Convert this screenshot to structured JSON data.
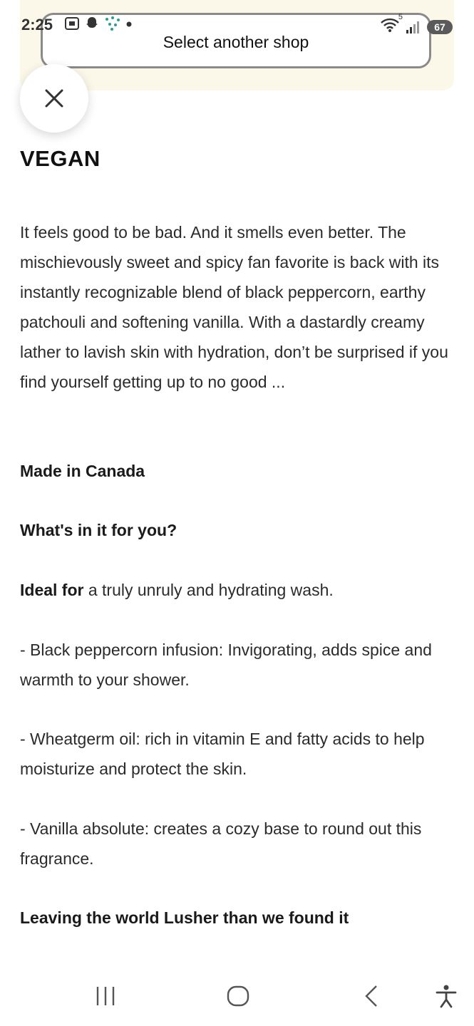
{
  "status_bar": {
    "time": "2:25",
    "wifi_label": "5",
    "battery": "67"
  },
  "shop_banner": {
    "button_label": "Select another shop"
  },
  "product": {
    "title": "VEGAN",
    "description": "It feels good to be bad. And it smells even better. The mischievously sweet and spicy fan favorite is back with its instantly recognizable blend of black peppercorn, earthy patchouli and softening vanilla. With a dastardly creamy lather to lavish skin with hydration, don’t be surprised if you find yourself getting up to no good ...",
    "made_in": "Made in Canada",
    "whats_in_heading": "What's in it for you?",
    "ideal_for_label": "Ideal for",
    "ideal_for_text": " a truly unruly and hydrating wash.",
    "bullets": [
      "- Black peppercorn infusion: Invigorating, adds spice and warmth to your shower.",
      "- Wheatgerm oil: rich in vitamin E and fatty acids to help moisturize and protect the skin.",
      "- Vanilla absolute: creates a cozy base to round out this fragrance."
    ],
    "closing_heading": "Leaving the world Lusher than we found it"
  },
  "icons": {
    "close": "close-icon",
    "recents": "recents-icon",
    "home": "home-icon",
    "back": "back-icon",
    "accessibility": "accessibility-icon"
  }
}
